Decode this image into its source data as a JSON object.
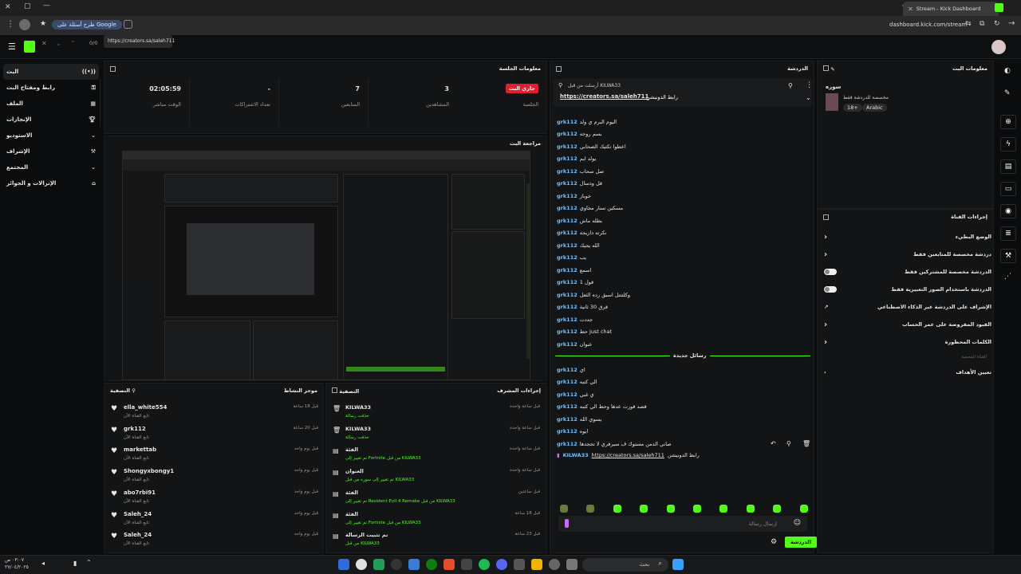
{
  "browser": {
    "tab_title": "Stream - Kick Dashboard",
    "google_pill": "طرح أسئلة على Google",
    "url_right": "dashboard.kick.com/stream",
    "counter": "0/0",
    "find_url": "https://creators.sa/saleh711"
  },
  "sidebar": {
    "items": [
      {
        "label": "البث"
      },
      {
        "label": "رابط ومفتاح البث"
      },
      {
        "label": "الملف"
      },
      {
        "label": "الإنجازات"
      },
      {
        "label": "الاستوديو"
      },
      {
        "label": "الإشراف"
      },
      {
        "label": "المجتمع"
      },
      {
        "label": "الإنزالات و الجوائز"
      }
    ]
  },
  "session": {
    "title": "معلومات الجلسة",
    "live_badge": "جاري البث",
    "live_caption": "الجلسة",
    "stats": [
      {
        "value": "3",
        "label": "المشاهدين"
      },
      {
        "value": "7",
        "label": "المتابعين"
      },
      {
        "value": "-",
        "label": "تعداد الاشتراكات"
      },
      {
        "value": "02:05:59",
        "label": "الوقت مباشر"
      }
    ]
  },
  "preview": {
    "title": "مراجعة البث"
  },
  "activity": {
    "title": "موجز النشاط",
    "filter": "التصفية",
    "rows": [
      {
        "user": "ella_white554",
        "sub": "تابع القناة الآن",
        "time": "قبل 18 ساعة"
      },
      {
        "user": "grk112",
        "sub": "تابع القناة الآن",
        "time": "قبل 20 ساعة"
      },
      {
        "user": "markettab",
        "sub": "تابع القناة الآن",
        "time": "قبل يوم واحد"
      },
      {
        "user": "Shongyxbongy1",
        "sub": "تابع القناة الآن",
        "time": "قبل يوم واحد"
      },
      {
        "user": "abo7rbi91",
        "sub": "تابع القناة الآن",
        "time": "قبل يوم واحد"
      },
      {
        "user": "Saleh_24",
        "sub": "تابع القناة الآن",
        "time": "قبل يوم واحد"
      },
      {
        "user": "Saleh_24",
        "sub": "تابع القناة الآن",
        "time": "قبل يوم واحد"
      }
    ]
  },
  "modactions": {
    "title": "إجراءات المشرف",
    "filter": "التصفية",
    "rows": [
      {
        "head": "KILWA33",
        "sub": "حذفت رسالة",
        "time": "قبل ساعة واحدة"
      },
      {
        "head": "KILWA33",
        "sub": "حذفت رسالة",
        "time": "قبل ساعة واحدة"
      },
      {
        "head": "الفئة",
        "sub": "تم تغيير إلى Fortnite من قبل KILWA33",
        "time": "قبل ساعة واحدة"
      },
      {
        "head": "العنوان",
        "sub": "تم تغيير إلى سوره من قبل KILWA33",
        "time": "قبل ساعة واحدة"
      },
      {
        "head": "الفئة",
        "sub": "تم تغيير إلى Resident Evil 4 Remake من قبل KILWA33",
        "time": "قبل ساعتين"
      },
      {
        "head": "الفئة",
        "sub": "تم تغيير إلى Fortnite من قبل KILWA33",
        "time": "قبل 18 ساعة"
      },
      {
        "head": "تم تثبيت الرسالة",
        "sub": "من قبل KILWA33",
        "time": "قبل 23 ساعة"
      }
    ]
  },
  "chat": {
    "title": "الدردشة",
    "pinned_by": "أرسلت من قبل KILWA33",
    "pinned_link": "https://creators.sa/saleh711",
    "pinned_text": "رابط الدونيشن",
    "lines_top": [
      {
        "user": "grk112",
        "msg": "اليوم البرم ي ولد"
      },
      {
        "user": "grk112",
        "msg": "بسم روحه"
      },
      {
        "user": "grk112",
        "msg": "اعطوا تكتيك الصحابي"
      },
      {
        "user": "grk112",
        "msg": "يولد ايم"
      },
      {
        "user": "grk112",
        "msg": "صل سحاب"
      },
      {
        "user": "grk112",
        "msg": "قل ودسال"
      },
      {
        "user": "grk112",
        "msg": "خوباز"
      },
      {
        "user": "grk112",
        "msg": "مسكين سنار مجاوي"
      },
      {
        "user": "grk112",
        "msg": "بطله ماش"
      },
      {
        "user": "grk112",
        "msg": "نكرته دازيجه"
      },
      {
        "user": "grk112",
        "msg": "الله يجيك"
      },
      {
        "user": "grk112",
        "msg": "يب"
      },
      {
        "user": "grk112",
        "msg": "اسمع"
      },
      {
        "user": "grk112",
        "msg": "قول 1"
      },
      {
        "user": "grk112",
        "msg": "وكلتتتل اسبق رده الثعل"
      },
      {
        "user": "grk112",
        "msg": "قرق 30 ثانية"
      },
      {
        "user": "grk112",
        "msg": "جددت"
      },
      {
        "user": "grk112",
        "msg": "حط just chat"
      },
      {
        "user": "grk112",
        "msg": "عنوان"
      }
    ],
    "new_messages": "رسائل جديدة",
    "lines_bottom": [
      {
        "user": "grk112",
        "msg": "اي"
      },
      {
        "user": "grk112",
        "msg": "الي كتبه"
      },
      {
        "user": "grk112",
        "msg": "ي غبي"
      },
      {
        "user": "grk112",
        "msg": "قصد قورت عدها وحط الي كتبه"
      },
      {
        "user": "grk112",
        "msg": "يسوي الله"
      },
      {
        "user": "grk112",
        "msg": "ايوه"
      },
      {
        "user": "grk112",
        "msg": "صاني الدمن مستوك ف سيرفري لا تحجدها"
      }
    ],
    "last_user": "KILWA33",
    "last_link": "https://creators.sa/saleh711",
    "last_text": "رابط الدونيشن",
    "input_placeholder": "إرسال رسالة",
    "send_label": "الدردشة"
  },
  "streaminfo": {
    "title": "معلومات البث",
    "stream_title": "سوره",
    "category_line": "مخصصة للدردشة فقط",
    "tag1": "18+",
    "tag2": "Arabic"
  },
  "channel": {
    "title": "إجراءات القناة",
    "rows": [
      {
        "label": "الوضع البطيء",
        "ctrl": "chevron"
      },
      {
        "label": "دردشة مخصصة للمتابعين فقط",
        "ctrl": "chevron"
      },
      {
        "label": "الدردشة مخصصة للمشتركين فقط",
        "ctrl": "toggle"
      },
      {
        "label": "الدردشة باستخدام الصور التعبيرية فقط",
        "ctrl": "toggle"
      },
      {
        "label": "الإشراف على الدردشة عبر الذكاء الاصطناعي",
        "ctrl": "link"
      },
      {
        "label": "القيود المفروضة على عمر الحساب",
        "ctrl": "chevron"
      },
      {
        "label": "الكلمات المحظورة",
        "ctrl": "chevron"
      }
    ],
    "section": "القناة المحمية",
    "goal": "تعيين الأهداف"
  },
  "taskbar": {
    "search": "بحث",
    "time": "٠٣:٠٧ ص",
    "date": "٢٧/٠٤/٢٠٢٥"
  },
  "colors": {
    "accent": "#53fc18",
    "live": "#e11d2e",
    "link": "#6ec3ff"
  }
}
